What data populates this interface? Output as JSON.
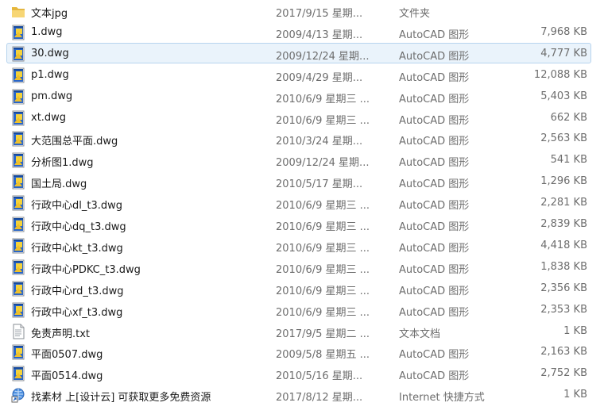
{
  "files": [
    {
      "name": "文本jpg",
      "date": "2017/9/15 星期...",
      "type": "文件夹",
      "size": "",
      "icon": "folder-icon"
    },
    {
      "name": "1.dwg",
      "date": "2009/4/13 星期...",
      "type": "AutoCAD 图形",
      "size": "7,968 KB",
      "icon": "dwg-file-icon"
    },
    {
      "name": "30.dwg",
      "date": "2009/12/24 星期...",
      "type": "AutoCAD 图形",
      "size": "4,777 KB",
      "icon": "dwg-file-icon",
      "selected": true
    },
    {
      "name": "p1.dwg",
      "date": "2009/4/29 星期...",
      "type": "AutoCAD 图形",
      "size": "12,088 KB",
      "icon": "dwg-file-icon"
    },
    {
      "name": "pm.dwg",
      "date": "2010/6/9 星期三 ...",
      "type": "AutoCAD 图形",
      "size": "5,403 KB",
      "icon": "dwg-file-icon"
    },
    {
      "name": "xt.dwg",
      "date": "2010/6/9 星期三 ...",
      "type": "AutoCAD 图形",
      "size": "662 KB",
      "icon": "dwg-file-icon"
    },
    {
      "name": "大范围总平面.dwg",
      "date": "2010/3/24 星期...",
      "type": "AutoCAD 图形",
      "size": "2,563 KB",
      "icon": "dwg-file-icon"
    },
    {
      "name": "分析图1.dwg",
      "date": "2009/12/24 星期...",
      "type": "AutoCAD 图形",
      "size": "541 KB",
      "icon": "dwg-file-icon"
    },
    {
      "name": "国土局.dwg",
      "date": "2010/5/17 星期...",
      "type": "AutoCAD 图形",
      "size": "1,296 KB",
      "icon": "dwg-file-icon"
    },
    {
      "name": "行政中心dl_t3.dwg",
      "date": "2010/6/9 星期三 ...",
      "type": "AutoCAD 图形",
      "size": "2,281 KB",
      "icon": "dwg-file-icon"
    },
    {
      "name": "行政中心dq_t3.dwg",
      "date": "2010/6/9 星期三 ...",
      "type": "AutoCAD 图形",
      "size": "2,839 KB",
      "icon": "dwg-file-icon"
    },
    {
      "name": "行政中心kt_t3.dwg",
      "date": "2010/6/9 星期三 ...",
      "type": "AutoCAD 图形",
      "size": "4,418 KB",
      "icon": "dwg-file-icon"
    },
    {
      "name": "行政中心PDKC_t3.dwg",
      "date": "2010/6/9 星期三 ...",
      "type": "AutoCAD 图形",
      "size": "1,838 KB",
      "icon": "dwg-file-icon"
    },
    {
      "name": "行政中心rd_t3.dwg",
      "date": "2010/6/9 星期三 ...",
      "type": "AutoCAD 图形",
      "size": "2,356 KB",
      "icon": "dwg-file-icon"
    },
    {
      "name": "行政中心xf_t3.dwg",
      "date": "2010/6/9 星期三 ...",
      "type": "AutoCAD 图形",
      "size": "2,353 KB",
      "icon": "dwg-file-icon"
    },
    {
      "name": "免责声明.txt",
      "date": "2017/9/5 星期二 ...",
      "type": "文本文档",
      "size": "1 KB",
      "icon": "text-file-icon"
    },
    {
      "name": "平面0507.dwg",
      "date": "2009/5/8 星期五 ...",
      "type": "AutoCAD 图形",
      "size": "2,163 KB",
      "icon": "dwg-file-icon"
    },
    {
      "name": "平面0514.dwg",
      "date": "2010/5/16 星期...",
      "type": "AutoCAD 图形",
      "size": "2,752 KB",
      "icon": "dwg-file-icon"
    },
    {
      "name": "找素材 上[设计云] 可获取更多免费资源",
      "date": "2017/8/12 星期...",
      "type": "Internet 快捷方式",
      "size": "1 KB",
      "icon": "internet-shortcut-icon"
    }
  ]
}
